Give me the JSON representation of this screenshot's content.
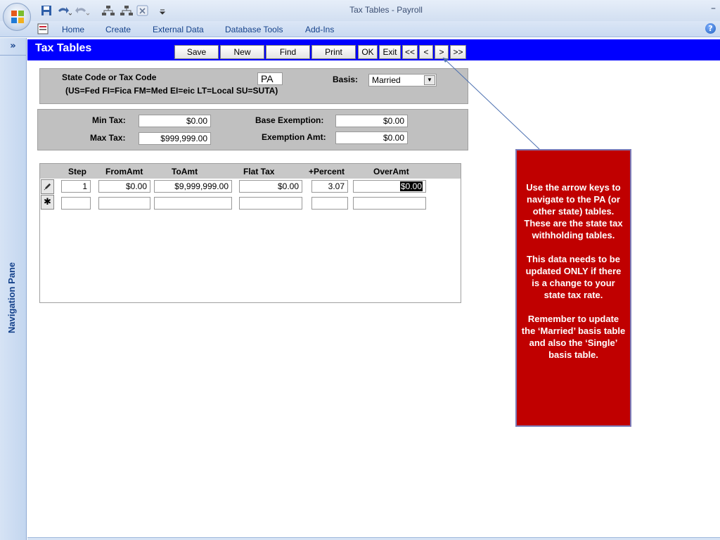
{
  "window": {
    "title": "Tax Tables - Payroll",
    "minimize_glyph": "–"
  },
  "ribbon": {
    "tabs": [
      "Home",
      "Create",
      "External Data",
      "Database Tools",
      "Add-Ins"
    ],
    "help_glyph": "?"
  },
  "nav_pane": {
    "label": "Navigation Pane",
    "toggle_glyph": "»"
  },
  "form": {
    "title": "Tax Tables",
    "buttons": {
      "save": "Save",
      "new": "New",
      "find": "Find",
      "print": "Print",
      "ok": "OK",
      "exit": "Exit",
      "first": "<<",
      "prev": "<",
      "next": ">",
      "last": ">>"
    },
    "state_code_label": "State Code  or Tax Code",
    "codes_hint": "(US=Fed FI=Fica FM=Med EI=eic LT=Local SU=SUTA)",
    "state_code_value": "PA",
    "basis_label": "Basis:",
    "basis_value": "Married",
    "min_tax_label": "Min Tax:",
    "min_tax_value": "$0.00",
    "max_tax_label": "Max Tax:",
    "max_tax_value": "$999,999.00",
    "base_exemption_label": "Base Exemption:",
    "base_exemption_value": "$0.00",
    "exemption_amt_label": "Exemption Amt:",
    "exemption_amt_value": "$0.00"
  },
  "table": {
    "columns": [
      "Step",
      "FromAmt",
      "ToAmt",
      "Flat Tax",
      "+Percent",
      "OverAmt"
    ],
    "rows": [
      {
        "step": "1",
        "from_amt": "$0.00",
        "to_amt": "$9,999,999.00",
        "flat_tax": "$0.00",
        "percent": "3.07",
        "over_amt": "$0.00"
      }
    ],
    "new_row_glyph": "✱"
  },
  "callout": {
    "p1": "Use the arrow keys to navigate to the PA (or other state) tables. These are the state tax withholding tables.",
    "p2": "This data needs to be updated ONLY if there is a change to your state tax rate.",
    "p3": "Remember to update the ‘Married’ basis table and also the ‘Single’ basis table."
  },
  "colors": {
    "form_header": "#0000ff",
    "callout_bg": "#c00000",
    "panel_bg": "#c0c0c0",
    "ribbon_text": "#15428b"
  }
}
